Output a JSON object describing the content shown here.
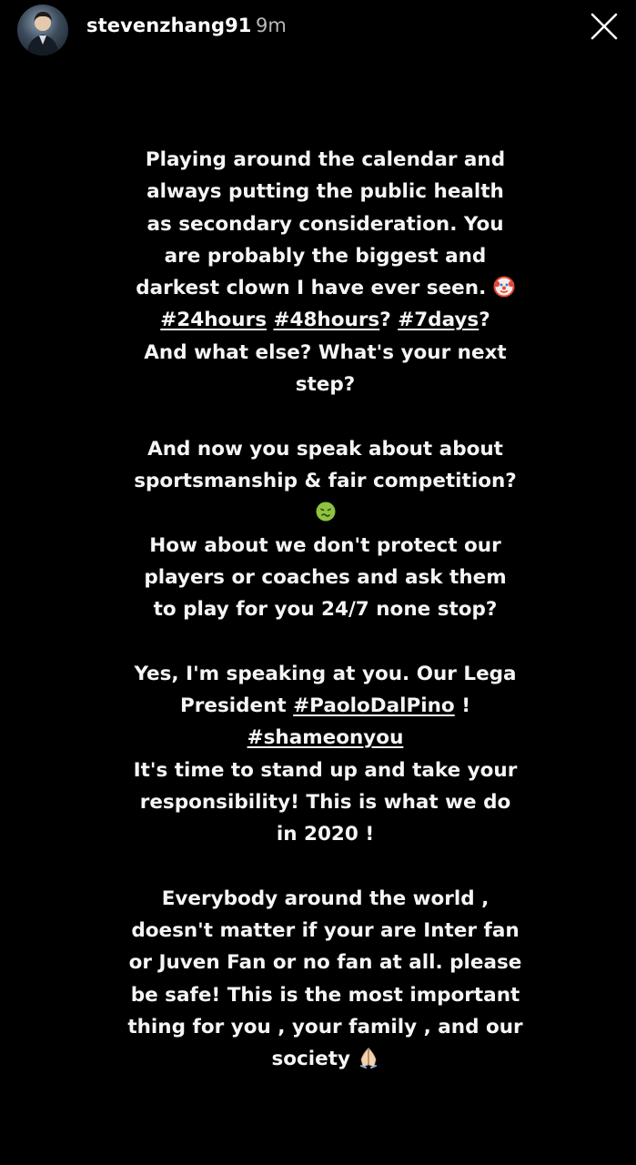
{
  "header": {
    "username": "stevenzhang91",
    "time": "9m",
    "avatar_icon": "avatar-photo",
    "close_icon": "close-icon"
  },
  "story": {
    "text": {
      "l1": "Playing around the calendar and",
      "l2": "always putting the public health",
      "l3": "as secondary consideration. You",
      "l4": "are probably the biggest and",
      "l5": "darkest clown I have ever seen.",
      "l6_tag1": "#24hours",
      "l6_tag2": "#48hours",
      "l6_mid": "?",
      "l6_tag3": "#7days",
      "l6_end": "?",
      "l7": "And what else?  What's your next",
      "l8": "step?",
      "l9": "And now you speak about about",
      "l10": "sportsmanship & fair competition?",
      "l11": "How about we don't protect our",
      "l12": "players or coaches and ask them",
      "l13": "to play for you 24/7 none stop?",
      "l14": "Yes, I'm speaking at you. Our Lega",
      "l15_pre": "President ",
      "l15_tag": "#PaoloDalPino",
      "l15_post": " !",
      "l16_tag": "#shameonyou",
      "l17": "It's time to stand up and take your",
      "l18": "responsibility!  This is what we do",
      "l19": "in 2020 !",
      "l20": "Everybody around the world ,",
      "l21": "doesn't matter if your are Inter fan",
      "l22": "or Juven Fan or no fan at all. please",
      "l23": "be safe! This is the most important",
      "l24": "thing for you , your family , and our",
      "l25": "society"
    },
    "emojis": [
      "clown-face-emoji",
      "nauseated-face-emoji",
      "folded-hands-emoji"
    ]
  },
  "colors": {
    "background": "#000000",
    "text": "#f5f5f5",
    "timestamp": "#b9b9b9"
  }
}
